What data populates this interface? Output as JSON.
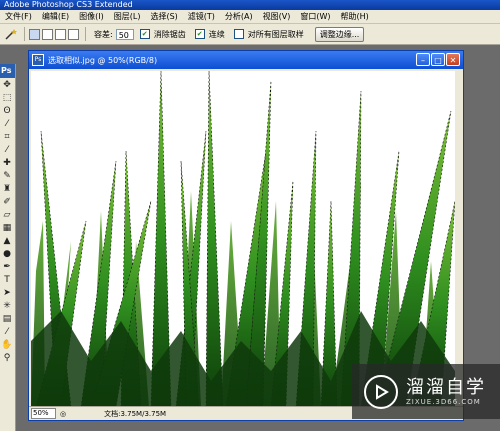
{
  "app": {
    "title": "Adobe Photoshop CS3 Extended"
  },
  "menu": [
    "文件(F)",
    "编辑(E)",
    "图像(I)",
    "图层(L)",
    "选择(S)",
    "滤镜(T)",
    "分析(A)",
    "视图(V)",
    "窗口(W)",
    "帮助(H)"
  ],
  "options": {
    "tolerance_label": "容差:",
    "tolerance_value": "50",
    "antialias_label": "消除锯齿",
    "contiguous_label": "连续",
    "all_layers_label": "对所有图层取样",
    "refine_edge_label": "调整边缘..."
  },
  "toolbox": {
    "badge": "Ps"
  },
  "document": {
    "title": "选取相似.jpg @ 50%(RGB/8)",
    "zoom": "50%",
    "doc_info": "文档:3.75M/3.75M"
  },
  "watermark": {
    "brand": "溜溜自学",
    "url": "ZIXUE.3D66.COM"
  }
}
